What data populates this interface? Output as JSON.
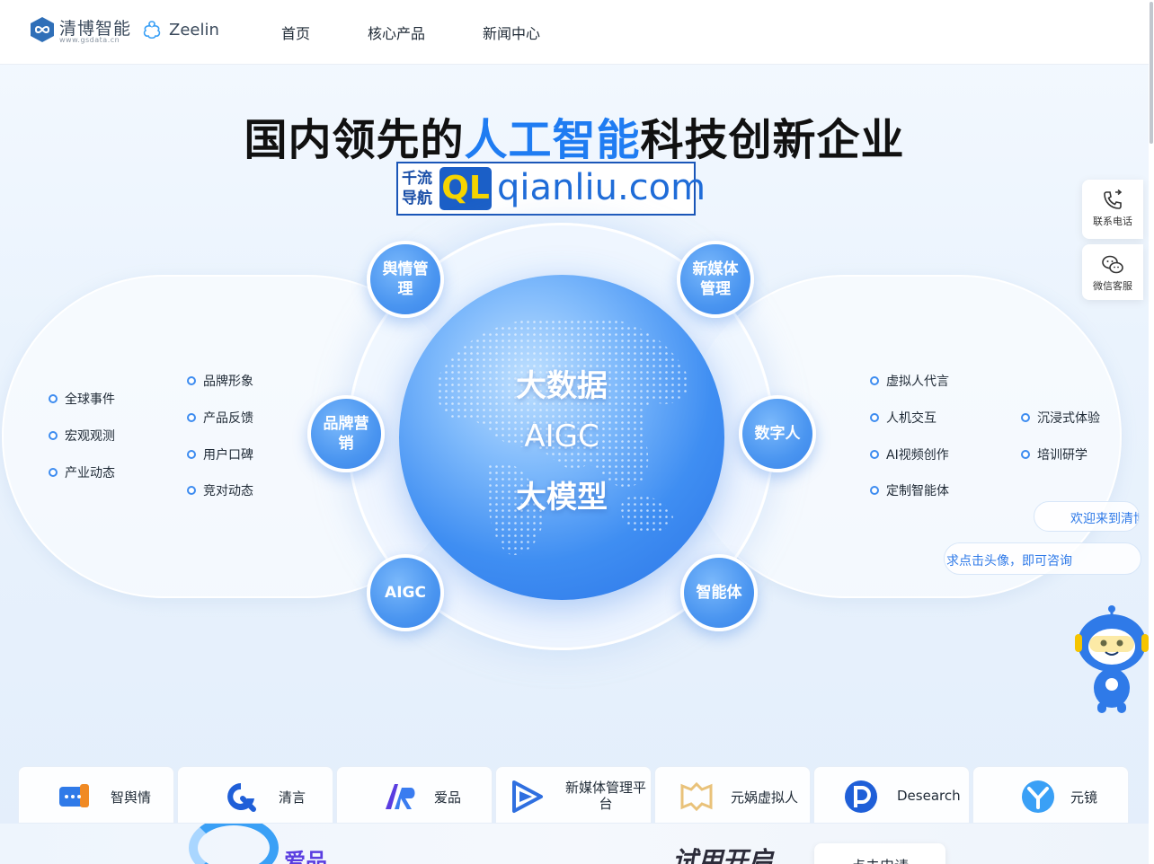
{
  "header": {
    "logo_name": "清博智能",
    "logo_url": "www.gsdata.cn",
    "partner_name": "Zeelin",
    "nav": [
      "首页",
      "核心产品",
      "新闻中心"
    ]
  },
  "hero": {
    "title_pre": "国内领先的",
    "title_highlight": "人工智能",
    "title_post": "科技创新企业"
  },
  "ad": {
    "cn_text": "千流导航",
    "ql": "QL",
    "domain": "qianliu.com"
  },
  "globe": {
    "line1": "大数据",
    "line2": "AIGC",
    "line3": "大模型"
  },
  "nodes": {
    "yuqing": "舆情管理",
    "xinmeiti": "新媒体管理",
    "pinpai": "品牌营销",
    "shuziren": "数字人",
    "aigc": "AIGC",
    "zhinengti": "智能体"
  },
  "left_features": {
    "col1": [
      "全球事件",
      "宏观观测",
      "产业动态"
    ],
    "col2": [
      "品牌形象",
      "产品反馈",
      "用户口碑",
      "竞对动态"
    ]
  },
  "right_features": {
    "col1": [
      "虚拟人代言",
      "人机交互",
      "AI视频创作",
      "定制智能体"
    ],
    "col2": [
      "沉浸式体验",
      "培训研学"
    ]
  },
  "sidebar": {
    "phone_label": "联系电话",
    "wechat_label": "微信客服"
  },
  "chat": {
    "bubble1": "欢迎来到清博",
    "bubble2": "求点击头像，即可咨询"
  },
  "products": [
    "智舆情",
    "清言",
    "爱品",
    "新媒体管理平台",
    "元娲虚拟人",
    "Desearch",
    "元镜"
  ],
  "bottom": {
    "brand": "爱品",
    "title": "试用开启",
    "button": "点击申请"
  },
  "colors": {
    "accent": "#1f7cf2",
    "node": "#4a95f0",
    "globe": "#3f8ef2"
  }
}
